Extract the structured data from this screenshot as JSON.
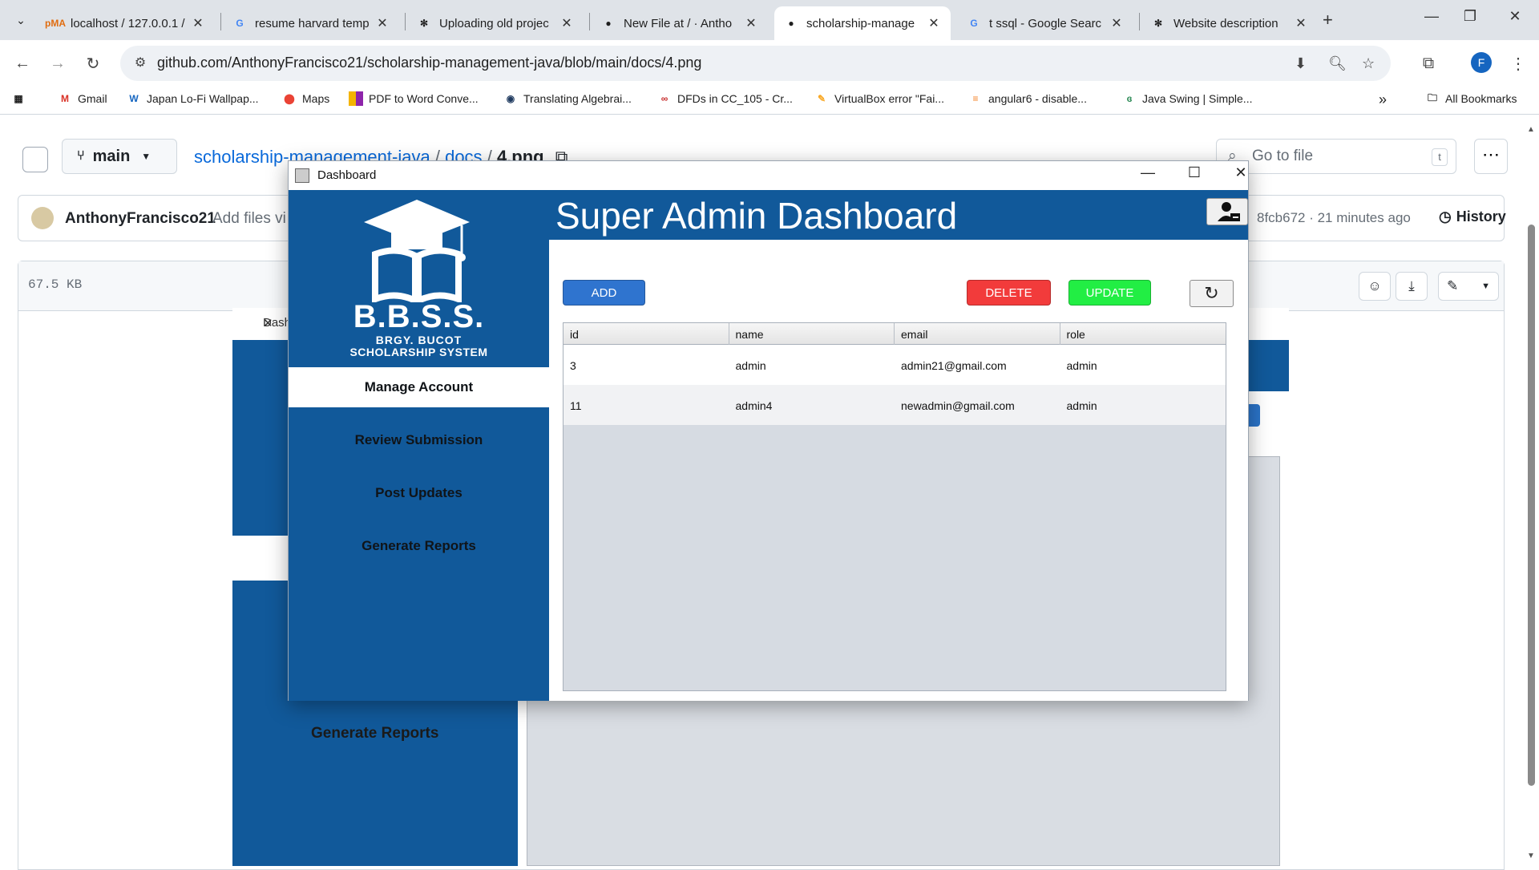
{
  "browser": {
    "tabs": [
      {
        "title": "localhost / 127.0.0.1 /",
        "favicon": "phpmyadmin-icon"
      },
      {
        "title": "resume harvard temp",
        "favicon": "google-icon"
      },
      {
        "title": "Uploading old projec",
        "favicon": "openai-icon"
      },
      {
        "title": "New File at / · Antho",
        "favicon": "github-icon"
      },
      {
        "title": "scholarship-manage",
        "favicon": "github-icon",
        "active": true
      },
      {
        "title": "t ssql - Google Searc",
        "favicon": "google-icon"
      },
      {
        "title": "Website description",
        "favicon": "openai-icon"
      }
    ],
    "url": "github.com/AnthonyFrancisco21/scholarship-management-java/blob/main/docs/4.png",
    "profile_initial": "F",
    "bookmarks": [
      {
        "label": "Gmail",
        "icon": "gmail-icon"
      },
      {
        "label": "Japan Lo-Fi Wallpap...",
        "icon": "w-icon"
      },
      {
        "label": "Maps",
        "icon": "maps-icon"
      },
      {
        "label": "PDF to Word Conve...",
        "icon": "pdf-icon"
      },
      {
        "label": "Translating Algebrai...",
        "icon": "translate-icon"
      },
      {
        "label": "DFDs in CC_105 - Cr...",
        "icon": "link-icon"
      },
      {
        "label": "VirtualBox error \"Fai...",
        "icon": "virtualbox-icon"
      },
      {
        "label": "angular6 - disable...",
        "icon": "stackoverflow-icon"
      },
      {
        "label": "Java Swing | Simple...",
        "icon": "gfg-icon"
      }
    ],
    "all_bookmarks_label": "All Bookmarks",
    "overflow_label": "»"
  },
  "github": {
    "branch": "main",
    "breadcrumb_repo": "scholarship-management-java",
    "breadcrumb_sep1": "/",
    "breadcrumb_folder": "docs",
    "breadcrumb_sep2": "/",
    "breadcrumb_file": "4.png",
    "goto_placeholder": "Go to file",
    "goto_key": "t",
    "commit_author": "AnthonyFrancisco21",
    "commit_message": "Add files vi",
    "commit_hash_time": "8fcb672 · 21 minutes ago",
    "history_label": "History",
    "file_size": "67.5 KB",
    "bg_window_title": "Dash",
    "bg_generate_reports": "Generate Reports"
  },
  "app": {
    "window_title": "Dashboard",
    "header_title": "Super Admin Dashboard",
    "logo_text": "B.B.S.S.",
    "logo_sub1": "BRGY. BUCOT",
    "logo_sub2": "SCHOLARSHIP SYSTEM",
    "menu": [
      {
        "label": "Manage Account",
        "active": true
      },
      {
        "label": "Review Submission",
        "active": false
      },
      {
        "label": "Post Updates",
        "active": false
      },
      {
        "label": "Generate Reports",
        "active": false
      }
    ],
    "buttons": {
      "add": "ADD",
      "delete": "DELETE",
      "update": "UPDATE"
    },
    "colors": {
      "primary": "#11599a",
      "add": "#2f74cf",
      "delete": "#f23b3b",
      "update": "#22ee44"
    },
    "table": {
      "columns": [
        "id",
        "name",
        "email",
        "role"
      ],
      "rows": [
        [
          "3",
          "admin",
          "admin21@gmail.com",
          "admin"
        ],
        [
          "11",
          "admin4",
          "newadmin@gmail.com",
          "admin"
        ]
      ]
    }
  }
}
